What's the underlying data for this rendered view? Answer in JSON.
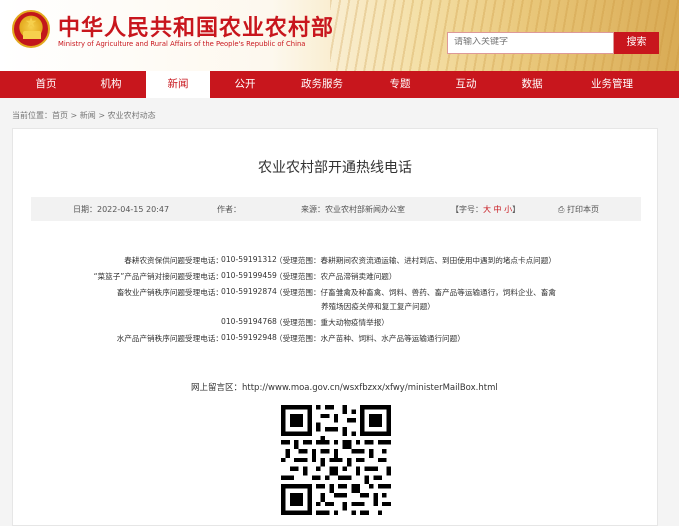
{
  "header": {
    "site_title": "中华人民共和国农业农村部",
    "site_subtitle": "Ministry of Agriculture and Rural Affairs of the People's Republic of China",
    "search_placeholder": "请输入关键字",
    "search_button": "搜索"
  },
  "nav": {
    "items": [
      {
        "label": "首页"
      },
      {
        "label": "机构"
      },
      {
        "label": "新闻"
      },
      {
        "label": "公开"
      },
      {
        "label": "政务服务"
      },
      {
        "label": "专题"
      },
      {
        "label": "互动"
      },
      {
        "label": "数据"
      },
      {
        "label": "业务管理"
      }
    ],
    "active_index": 2
  },
  "breadcrumb": {
    "text": "当前位置：首页 > 新闻 > 农业农村动态"
  },
  "article": {
    "title": "农业农村部开通热线电话",
    "date": "日期：2022-04-15 20:47",
    "author": "作者：",
    "source": "来源：农业农村部新闻办公室",
    "font_size_prefix": "【字号：",
    "font_large": "大",
    "font_medium": "中",
    "font_small": "小",
    "font_size_suffix": "】",
    "print": "打印本页",
    "hotlines": [
      {
        "label": "春耕农资保供问题受理电话：",
        "phone": "010-59191312",
        "scope": "（受理范围：春耕期间农资流通运输、进村到店、到田使用中遇到的堵点卡点问题）"
      },
      {
        "label": "“菜篮子”产品产销对接问题受理电话：",
        "phone": "010-59199459",
        "scope": "（受理范围：农产品滞销卖难问题）"
      },
      {
        "label": "畜牧业产销秩序问题受理电话：",
        "phone": "010-59192874",
        "scope": "（受理范围：仔畜雏禽及种畜禽、饲料、兽药、畜产品等运输通行，饲料企业、畜禽"
      },
      {
        "label": "",
        "phone": "",
        "scope": "养殖场因疫关停和复工复产问题）"
      },
      {
        "label": "",
        "phone": "010-59194768",
        "scope": "（受理范围：重大动物疫情举报）"
      },
      {
        "label": "水产品产销秩序问题受理电话：",
        "phone": "010-59192948",
        "scope": "（受理范围：水产苗种、饲料、水产品等运输通行问题）"
      }
    ],
    "mailbox": "网上留言区：http://www.moa.gov.cn/wsxfbzxx/xfwy/ministerMailBox.html"
  },
  "icons": {
    "emblem": "national-emblem-icon",
    "print": "printer-icon",
    "qr": "qr-code-icon"
  },
  "colors": {
    "brand_red": "#c8161d",
    "gold": "#e3a91e"
  }
}
